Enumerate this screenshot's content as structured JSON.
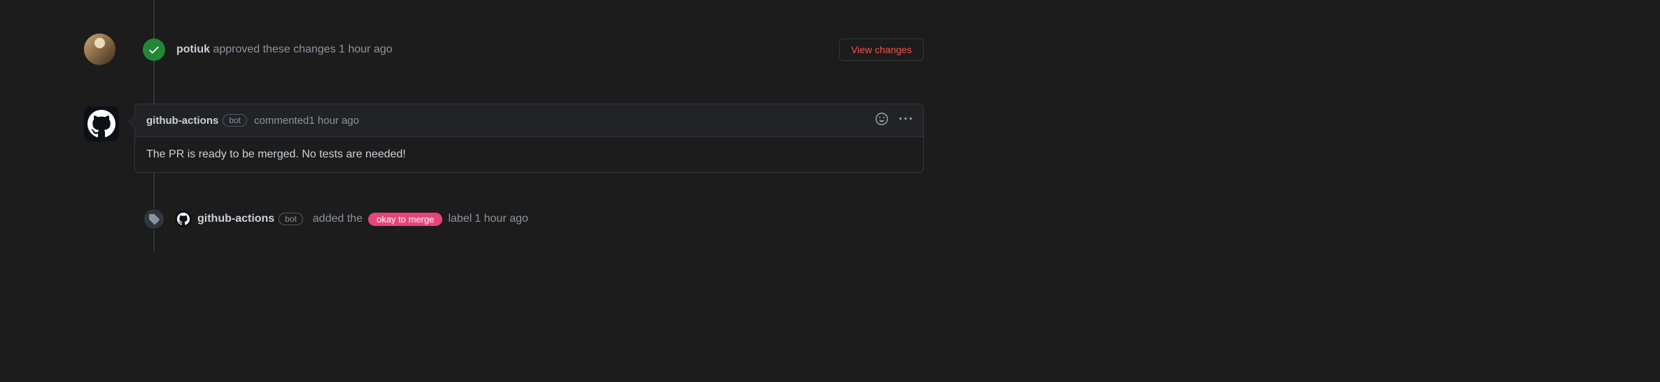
{
  "approval": {
    "author": "potiuk",
    "action_text": " approved these changes ",
    "timestamp": "1 hour ago",
    "view_changes_label": "View changes"
  },
  "comment": {
    "author": "github-actions",
    "bot_label": "bot",
    "action_text": "commented ",
    "timestamp": "1 hour ago",
    "body": "The PR is ready to be merged. No tests are needed!"
  },
  "label_event": {
    "author": "github-actions",
    "bot_label": "bot",
    "prefix_text": "added the",
    "label_name": "okay to merge",
    "suffix_text": "label ",
    "timestamp": "1 hour ago"
  }
}
